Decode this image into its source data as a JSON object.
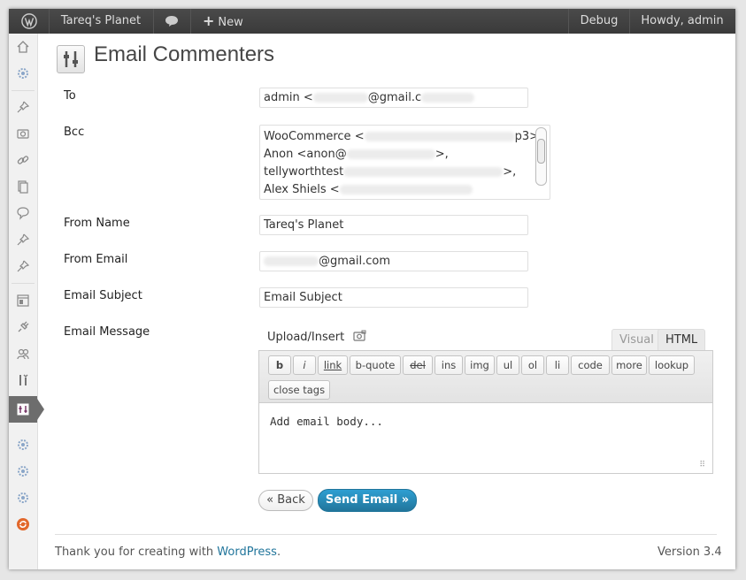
{
  "admin_bar": {
    "site_name": "Tareq's Planet",
    "new_label": "New",
    "debug_label": "Debug",
    "howdy_label": "Howdy, admin"
  },
  "page": {
    "title": "Email Commenters"
  },
  "form": {
    "to": {
      "label": "To",
      "value_prefix": "admin <",
      "value_mid": "@gmail.c"
    },
    "bcc": {
      "label": "Bcc",
      "lines": [
        {
          "start": "WooCommerce <",
          "end": "p3>,"
        },
        {
          "start": "Anon <anon@",
          "end": ">,"
        },
        {
          "start": "tellyworthtest",
          "end": ">,"
        },
        {
          "start": "Alex Shiels <",
          "end": ""
        }
      ]
    },
    "from_name": {
      "label": "From Name",
      "value": "Tareq's Planet"
    },
    "from_email": {
      "label": "From Email",
      "value_suffix": "@gmail.com"
    },
    "subject": {
      "label": "Email Subject",
      "value": "Email Subject"
    },
    "message": {
      "label": "Email Message"
    }
  },
  "editor": {
    "upload_label": "Upload/Insert",
    "tabs": {
      "visual": "Visual",
      "html": "HTML"
    },
    "buttons": [
      "b",
      "i",
      "link",
      "b-quote",
      "del",
      "ins",
      "img",
      "ul",
      "ol",
      "li",
      "code",
      "more",
      "lookup",
      "close tags"
    ],
    "body_text": "Add email body..."
  },
  "actions": {
    "back_label": "« Back",
    "send_label": "Send Email »"
  },
  "footer": {
    "thanks_prefix": "Thank you for creating with ",
    "wordpress_link": "WordPress",
    "thanks_suffix": ".",
    "version": "Version 3.4"
  },
  "colors": {
    "admin_bar": "#464646",
    "link": "#21759b",
    "primary_button": "#21759b",
    "active_menu": "#6d6d6d"
  }
}
